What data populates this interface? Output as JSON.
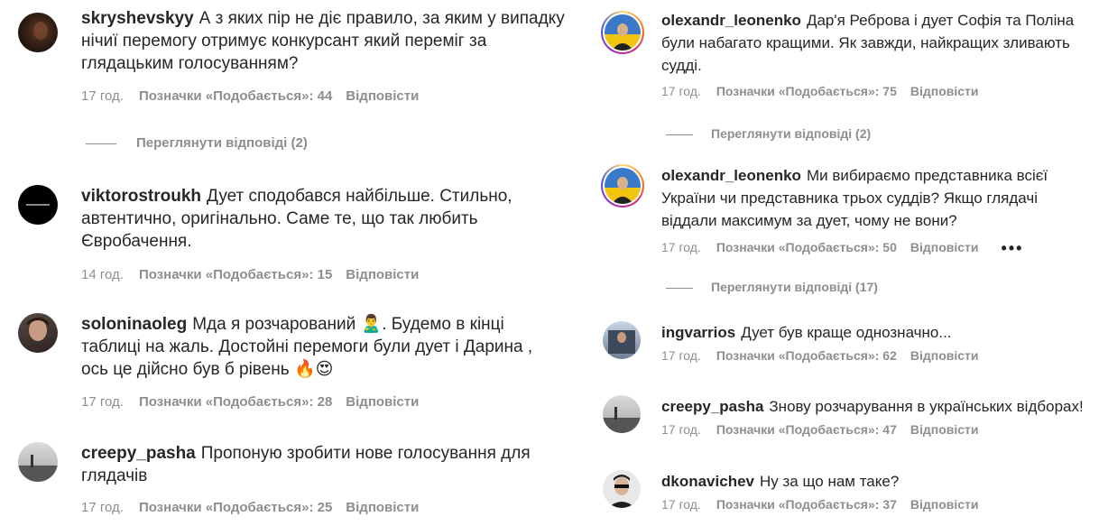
{
  "colors": {
    "text": "#262626",
    "muted": "#8e8e8e"
  },
  "icons": {
    "more": "more-horizontal-icon",
    "emoji_person": "person-emoji",
    "emoji_fire": "fire-emoji",
    "emoji_heart_eyes": "heart-eyes-emoji"
  },
  "left": [
    {
      "user": "skryshevskyy",
      "lines": [
        "А з яких пір не діє правило, за яким у випадку",
        "нічиї перемогу отримує конкурсант який переміг за",
        "глядацьким голосуванням?"
      ],
      "time": "17 год.",
      "likes": "Позначки «Подобається»: 44",
      "reply": "Відповісти",
      "view_replies": "Переглянути відповіді (2)"
    },
    {
      "user": "viktorostroukh",
      "lines": [
        "Дует сподобався найбільше. Стильно,",
        "автентично, оригінально. Саме те, що так любить",
        "Євробачення."
      ],
      "time": "14 год.",
      "likes": "Позначки «Подобається»: 15",
      "reply": "Відповісти"
    },
    {
      "user": "soloninaoleg",
      "line1": "Мда я розчарований",
      "line1b": ". Будемо в кінці",
      "line2": "таблиці на жаль. Достойні перемоги були дует і Дарина ,",
      "line3": "ось це дійсно був б рівень",
      "emoji_person": "🙎‍♂️",
      "emoji_fire": "🔥",
      "emoji_heart": "😍",
      "time": "17 год.",
      "likes": "Позначки «Подобається»: 28",
      "reply": "Відповісти"
    },
    {
      "user": "creepy_pasha",
      "lines": [
        "Пропоную зробити нове голосування для",
        "глядачів"
      ],
      "time": "17 год.",
      "likes": "Позначки «Подобається»: 25",
      "reply": "Відповісти"
    }
  ],
  "right": [
    {
      "user": "olexandr_leonenko",
      "lines": [
        "Дар'я Реброва і дует Софія та Поліна",
        "були набагато кращими. Як завжди, найкращих зливають",
        "судді."
      ],
      "time": "17 год.",
      "likes": "Позначки «Подобається»: 75",
      "reply": "Відповісти",
      "view_replies": "Переглянути відповіді (2)"
    },
    {
      "user": "olexandr_leonenko",
      "lines": [
        "Ми вибираємо представника всієї",
        "України чи представника трьох суддів? Якщо глядачі",
        "віддали максимум за дует, чому не вони?"
      ],
      "time": "17 год.",
      "likes": "Позначки «Подобається»: 50",
      "reply": "Відповісти",
      "more": "•••",
      "view_replies": "Переглянути відповіді (17)"
    },
    {
      "user": "ingvarrios",
      "lines": [
        "Дует був краще однозначно..."
      ],
      "time": "17 год.",
      "likes": "Позначки «Подобається»: 62",
      "reply": "Відповісти"
    },
    {
      "user": "creepy_pasha",
      "lines": [
        "Знову розчарування в українських відборах!"
      ],
      "time": "17 год.",
      "likes": "Позначки «Подобається»: 47",
      "reply": "Відповісти"
    },
    {
      "user": "dkonavichev",
      "lines": [
        "Ну за що нам таке?"
      ],
      "time": "17 год.",
      "likes": "Позначки «Подобається»: 37",
      "reply": "Відповісти"
    }
  ]
}
